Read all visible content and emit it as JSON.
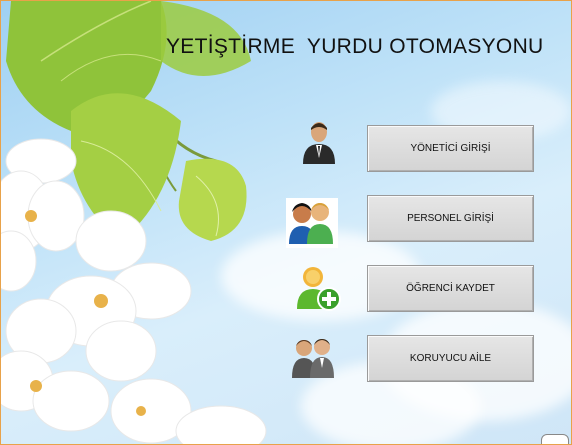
{
  "title": "YETİŞTİRME  YURDU OTOMASYONU",
  "buttons": [
    {
      "label": "YÖNETİCİ GİRİŞİ",
      "icon": "manager-icon"
    },
    {
      "label": "PERSONEL GİRİŞİ",
      "icon": "staff-icon"
    },
    {
      "label": "ÖĞRENCİ KAYDET",
      "icon": "add-student-icon"
    },
    {
      "label": "KORUYUCU AİLE",
      "icon": "foster-family-icon"
    }
  ],
  "colors": {
    "window_border": "#e8a24a",
    "button_bg": "#dcdcdc",
    "sky": "#bfe2f8"
  }
}
